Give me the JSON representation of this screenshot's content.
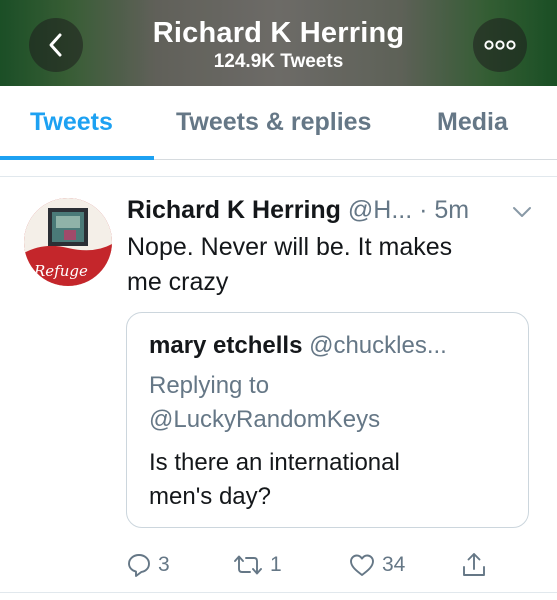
{
  "header": {
    "title": "Richard K Herring",
    "subtitle": "124.9K Tweets",
    "back_icon": "chevron-left-icon",
    "more_icon": "more-horizontal-icon"
  },
  "tabs": [
    {
      "label": "Tweets",
      "active": true
    },
    {
      "label": "Tweets & replies",
      "active": false
    },
    {
      "label": "Media",
      "active": false
    }
  ],
  "tweet": {
    "author_name": "Richard K Herring",
    "author_handle": "@H...",
    "time": "· 5m",
    "text_line1": "Nope. Never will be. It makes",
    "text_line2": "me crazy",
    "avatar_text": "Refuge"
  },
  "quoted_tweet": {
    "author_name": "mary etchells",
    "author_handle": "@chuckles...",
    "replying_label": "Replying to",
    "replying_handle": "@LuckyRandomKeys",
    "text_line1": "Is there an international",
    "text_line2": "men's day?"
  },
  "actions": {
    "reply_count": "3",
    "retweet_count": "1",
    "like_count": "34"
  },
  "colors": {
    "accent": "#1da1f2",
    "muted": "#657786",
    "text": "#14171a"
  }
}
